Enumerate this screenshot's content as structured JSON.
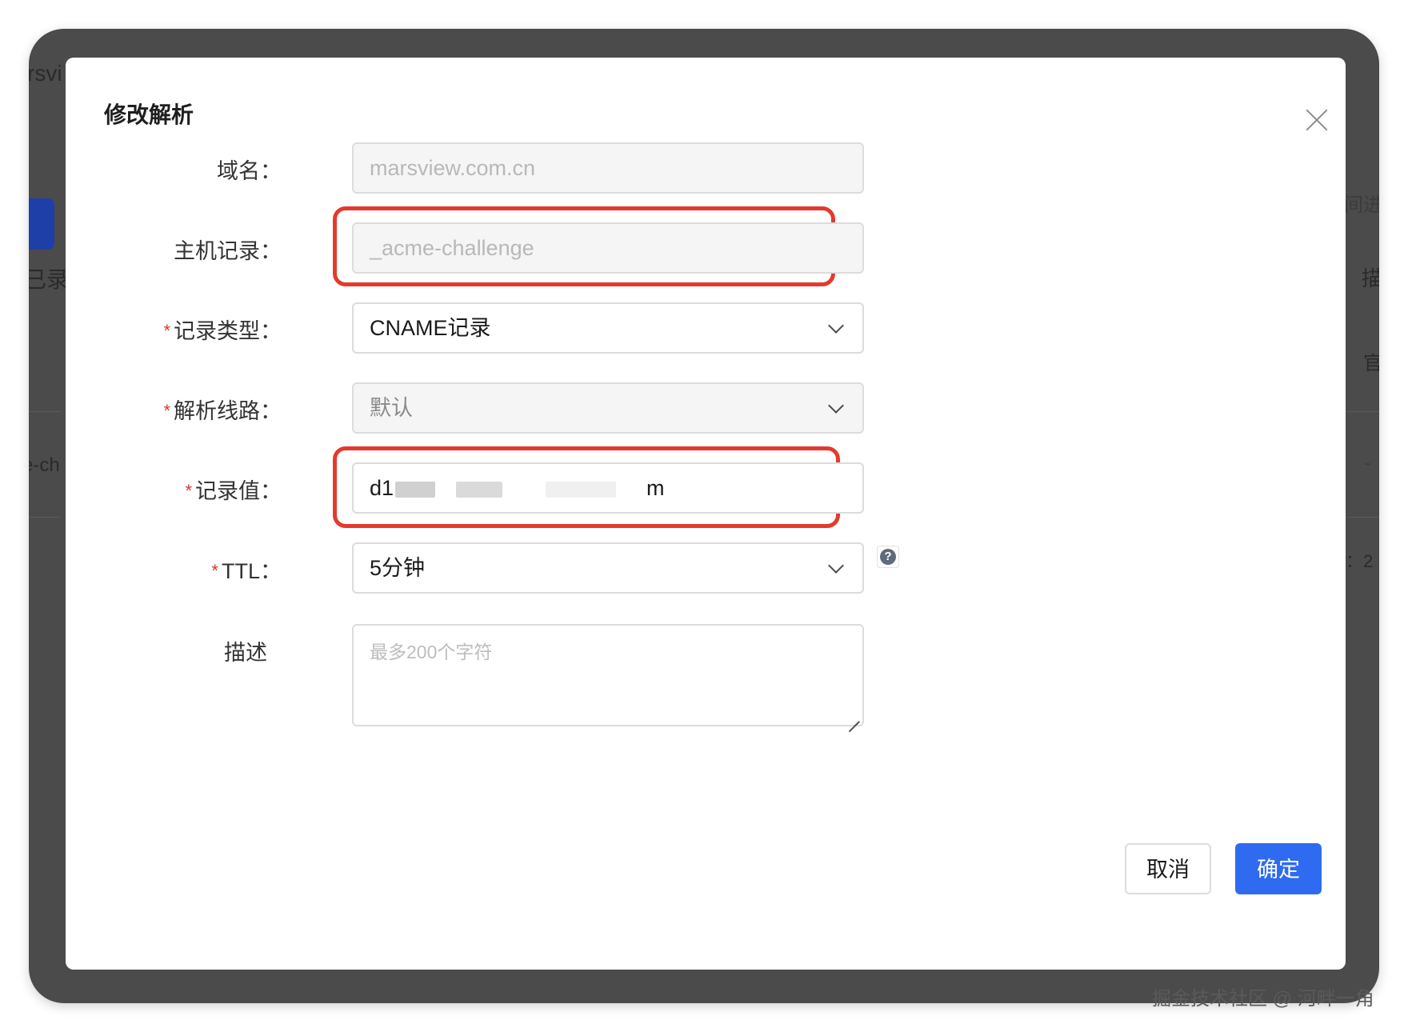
{
  "background": {
    "fragments": [
      "rsvi",
      "已录",
      "e-ch",
      "间进",
      "描",
      "官",
      "-",
      "：2"
    ]
  },
  "dialog": {
    "title": "修改解析",
    "fields": {
      "domain": {
        "label": "域名：",
        "value": "marsview.com.cn"
      },
      "host": {
        "label": "主机记录：",
        "value": "_acme-challenge"
      },
      "record_type": {
        "required": "*",
        "label": "记录类型：",
        "value": "CNAME记录"
      },
      "line": {
        "required": "*",
        "label": "解析线路：",
        "value": "默认"
      },
      "record_value": {
        "required": "*",
        "label": "记录值：",
        "value_prefix": "d1",
        "value_suffix": "m"
      },
      "ttl": {
        "required": "*",
        "label": "TTL：",
        "value": "5分钟",
        "help_icon": "?"
      },
      "description": {
        "label": "描述",
        "placeholder": "最多200个字符"
      }
    },
    "buttons": {
      "cancel": "取消",
      "ok": "确定"
    }
  },
  "colors": {
    "primary": "#2f6bf0",
    "highlight": "#e23b2e",
    "required": "#e0342b"
  },
  "watermark": "掘金技术社区 @ 河畔一角"
}
